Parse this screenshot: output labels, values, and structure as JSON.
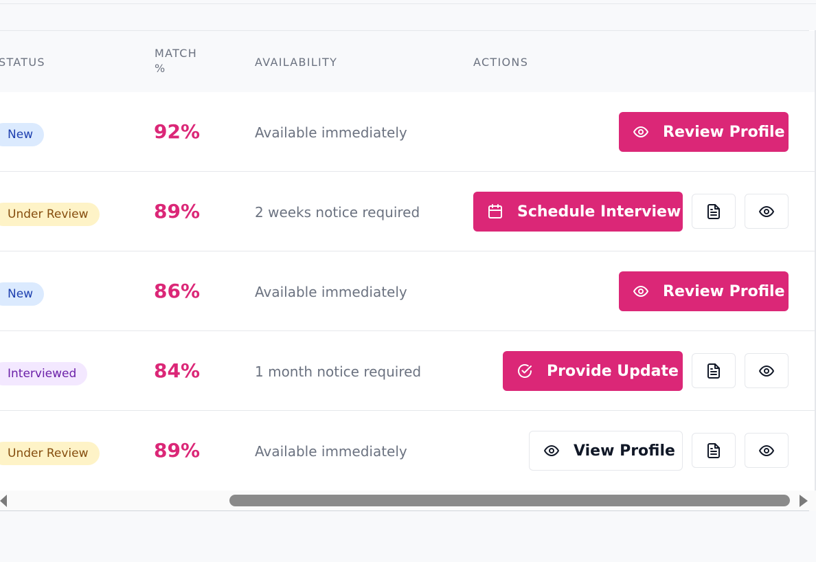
{
  "table": {
    "columns": {
      "status": "STATUS",
      "match": "MATCH %",
      "availability": "AVAILABILITY",
      "actions": "ACTIONS"
    },
    "rows": [
      {
        "status": "New",
        "status_type": "new",
        "match": "92%",
        "availability": "Available immediately",
        "primary_action": "Review Profile",
        "primary_icon": "eye-icon"
      },
      {
        "status": "Under Review",
        "status_type": "review",
        "match": "89%",
        "availability": "2 weeks notice required",
        "primary_action": "Schedule Interview",
        "primary_icon": "calendar-icon",
        "secondary_icons": [
          "document-icon",
          "eye-icon"
        ]
      },
      {
        "status": "New",
        "status_type": "new",
        "match": "86%",
        "availability": "Available immediately",
        "primary_action": "Review Profile",
        "primary_icon": "eye-icon"
      },
      {
        "status": "Interviewed",
        "status_type": "interviewed",
        "match": "84%",
        "availability": "1 month notice required",
        "primary_action": "Provide Update",
        "primary_icon": "check-circle-icon",
        "secondary_icons": [
          "document-icon",
          "eye-icon"
        ]
      },
      {
        "status": "Under Review",
        "status_type": "review",
        "match": "89%",
        "availability": "Available immediately",
        "primary_action": "View Profile",
        "primary_icon": "eye-icon",
        "secondary_icons": [
          "document-icon",
          "eye-icon"
        ]
      }
    ]
  },
  "colors": {
    "accent": "#db2777",
    "badge_new_bg": "#dbeafe",
    "badge_review_bg": "#fef3c7",
    "badge_interviewed_bg": "#f3e8ff"
  }
}
